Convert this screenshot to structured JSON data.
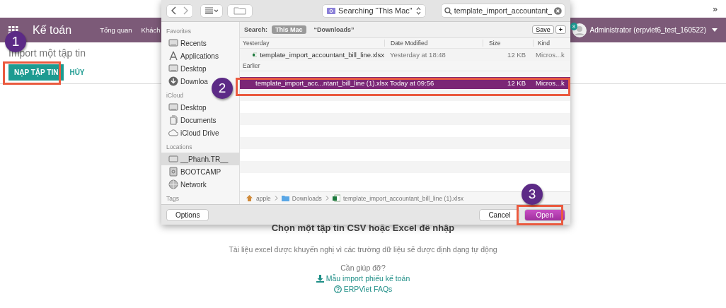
{
  "browser_bar": {
    "overflow": "»"
  },
  "navbar": {
    "app_title": "Kế toán",
    "menu": [
      "Tổng quan",
      "Khách"
    ],
    "notification_count": "8",
    "user": "Administrator (erpviet6_test_160522)"
  },
  "page": {
    "title": "Import một tập tin",
    "buttons": [
      {
        "label": "NẠP TẬP TIN",
        "kind": "primary"
      },
      {
        "label": "HỦY",
        "kind": "link"
      }
    ],
    "heading": "Chọn một tập tin CSV hoặc Excel để nhập",
    "description": "Tài liệu excel được khuyến nghị vì các trường dữ liệu sẽ được định dạng tự động",
    "help_label": "Cần giúp đỡ?",
    "links": [
      {
        "label": "Mẫu import phiếu kế toán",
        "kind": "download"
      },
      {
        "label": "ERPViet FAQs",
        "kind": "help"
      }
    ]
  },
  "dialog": {
    "location": "Searching “This Mac”",
    "search_value": "template_import_accountant_",
    "search_label": "Search:",
    "scopes": [
      {
        "label": "This Mac",
        "selected": true
      },
      {
        "label": "“Downloads”",
        "selected": false
      }
    ],
    "save_label": "Save",
    "add_label": "+",
    "sidebar": [
      {
        "heading": "Favorites",
        "items": [
          {
            "label": "Recents",
            "kind": "display",
            "selected": false
          },
          {
            "label": "Applications",
            "kind": "apps",
            "selected": false
          },
          {
            "label": "Desktop",
            "kind": "display",
            "selected": false
          },
          {
            "label": "Downloa",
            "kind": "download",
            "selected": false
          }
        ]
      },
      {
        "heading": "iCloud",
        "items": [
          {
            "label": "Desktop",
            "kind": "display",
            "selected": false
          },
          {
            "label": "Documents",
            "kind": "document",
            "selected": false
          },
          {
            "label": "iCloud Drive",
            "kind": "cloud",
            "selected": false
          }
        ]
      },
      {
        "heading": "Locations",
        "items": [
          {
            "label": "__Phanh.TR__",
            "kind": "laptop",
            "selected": true
          },
          {
            "label": "BOOTCAMP",
            "kind": "disk",
            "selected": false
          },
          {
            "label": "Network",
            "kind": "globe",
            "selected": false
          }
        ]
      },
      {
        "heading": "Tags"
      }
    ],
    "columns": [
      "Date Modified",
      "Size",
      "Kind"
    ],
    "groups": [
      {
        "label": "Yesterday",
        "rows": [
          {
            "kind": "file",
            "name": "template_import_accountant_bill_line.xlsx",
            "date": "Yesterday at 18:48",
            "size": "12 KB",
            "type": "Micros...k",
            "selected": false
          }
        ]
      },
      {
        "label": "Earlier",
        "rows": [
          {
            "kind": "obscured"
          },
          {
            "kind": "file",
            "name": "template_import_acc...ntant_bill_line (1).xlsx",
            "date": "Today at 09:56",
            "size": "12 KB",
            "type": "Micros...k",
            "selected": true
          }
        ]
      }
    ],
    "path": [
      {
        "label": "apple",
        "kind": "home"
      },
      {
        "label": "Downloads",
        "kind": "folder"
      },
      {
        "label": "template_import_accountant_bill_line (1).xlsx",
        "kind": "file"
      }
    ],
    "buttons": [
      {
        "label": "Options",
        "kind": "secondary"
      },
      {
        "label": "Cancel",
        "kind": "secondary"
      },
      {
        "label": "Open",
        "kind": "default"
      }
    ]
  },
  "annotations": [
    {
      "label": "1"
    },
    {
      "label": "2"
    },
    {
      "label": "3"
    }
  ]
}
